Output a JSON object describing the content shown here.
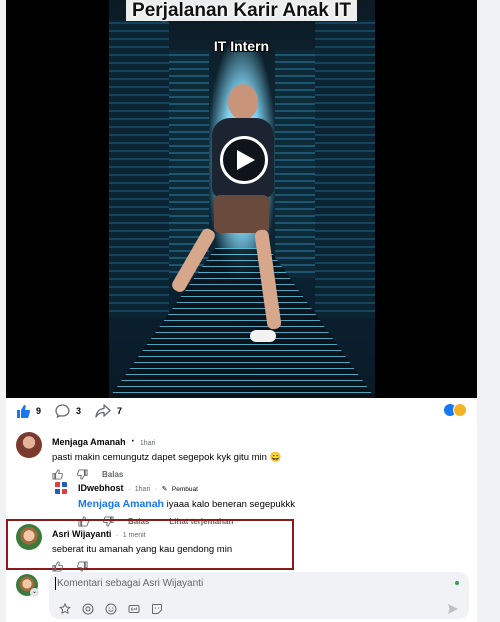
{
  "video": {
    "title": "Perjalanan Karir Anak IT",
    "subtitle": "IT Intern"
  },
  "reactions": {
    "likes": "9",
    "comments": "3",
    "shares": "7"
  },
  "comments": [
    {
      "author": "Menjaga Amanah",
      "time": "1hari",
      "text": "pasti makin cemungutz dapet segepok kyk gitu min 😀",
      "reply_label": "Balas"
    },
    {
      "author": "IDwebhost",
      "time": "1hari",
      "badge": "Pembuat",
      "mention": "Menjaga Amanah",
      "text": " iyaaa kalo beneran segepukkk",
      "reply_label": "Balas",
      "translate_label": "Lihat terjemahan"
    },
    {
      "author": "Asri Wijayanti",
      "time": "1 menit",
      "text": "seberat itu amanah yang kau gendong min"
    }
  ],
  "composer": {
    "placeholder": "Komentari sebagai Asri Wijayanti"
  },
  "colors": {
    "brand": "#1877f2",
    "highlight_border": "#8b1a1a",
    "online": "#31a24c"
  }
}
